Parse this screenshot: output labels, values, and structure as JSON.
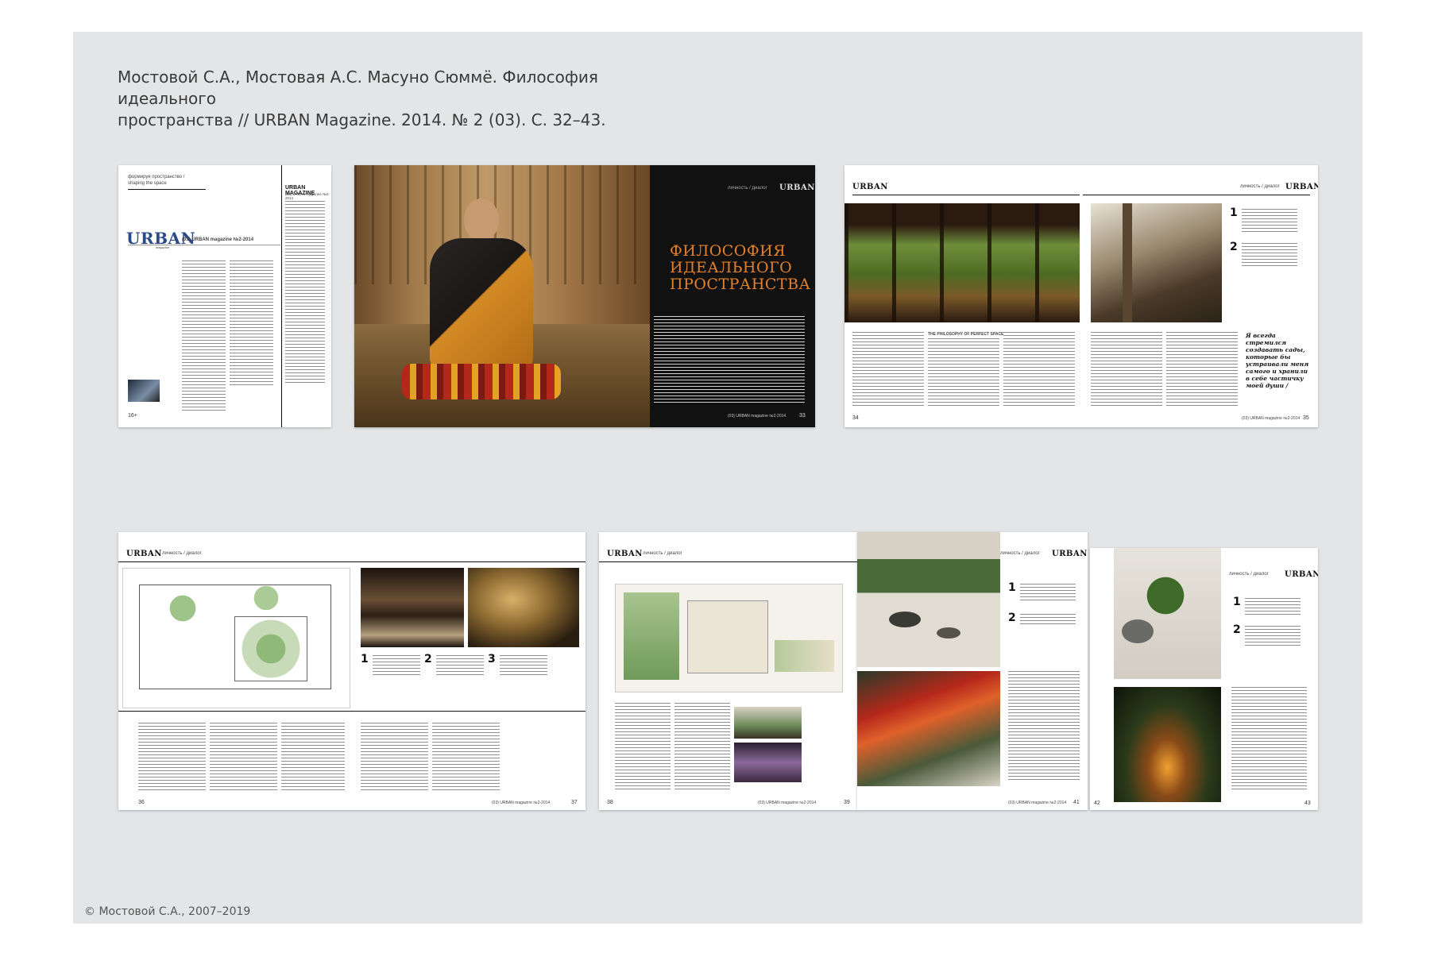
{
  "citation": {
    "line1": "Мостовой С.А., Мостовая А.С. Масуно Сюммё. Философия идеального",
    "line2": "пространства // URBAN Magazine. 2014. № 2 (03). С. 32–43."
  },
  "copyright": "© Мостовой С.А., 2007–2019",
  "spreads": {
    "masthead": {
      "rubric": "формируя пространство /",
      "rubric_en": "shaping the space",
      "logo": "URBAN",
      "logo_sub": "magazine",
      "issue": "(03) URBAN magazine №2-2014",
      "right_title": "URBAN MAGAZINE",
      "right_sub": "(03) URBAN magazine №2-2014",
      "age": "16+"
    },
    "opener": {
      "section": "личность / диалог",
      "logo": "URBAN",
      "title_line1": "ФИЛОСОФИЯ",
      "title_line2": "ИДЕАЛЬНОГО",
      "title_line3": "ПРОСТРАНСТВА",
      "footer": "(03) URBAN magazine №2-2014",
      "page": "33"
    },
    "spread_34_35": {
      "logo": "URBAN",
      "section": "личность / диалог",
      "en_heading": "THE PHILOSOPHY OF PERFECT SPACE",
      "page_left": "34",
      "page_right": "35",
      "footer": "(03) URBAN magazine №2-2014",
      "quote": "Я всегда стремился создавать сады, которые бы устраивали меня самого и хранили в себе частичку моей души /"
    },
    "spread_36_37": {
      "logo": "URBAN",
      "section": "личность / диалог",
      "page_left": "36",
      "page_right": "37",
      "footer": "(03) URBAN magazine №2-2014"
    },
    "spread_38_39": {
      "logo": "URBAN",
      "section": "личность / диалог",
      "page_left": "38",
      "page_right": "39",
      "footer": "(03) URBAN magazine №2-2014"
    },
    "spread_40_41": {
      "logo": "URBAN",
      "section": "личность / диалог",
      "page_right": "41",
      "footer": "(03) URBAN magazine №2-2014"
    },
    "spread_42_43": {
      "logo": "URBAN",
      "section": "личность / диалог",
      "page_left": "42",
      "page_right": "43"
    }
  },
  "colors": {
    "board": "#e4e5e6",
    "accent_orange": "#e2802b",
    "dark_page": "#111111"
  }
}
